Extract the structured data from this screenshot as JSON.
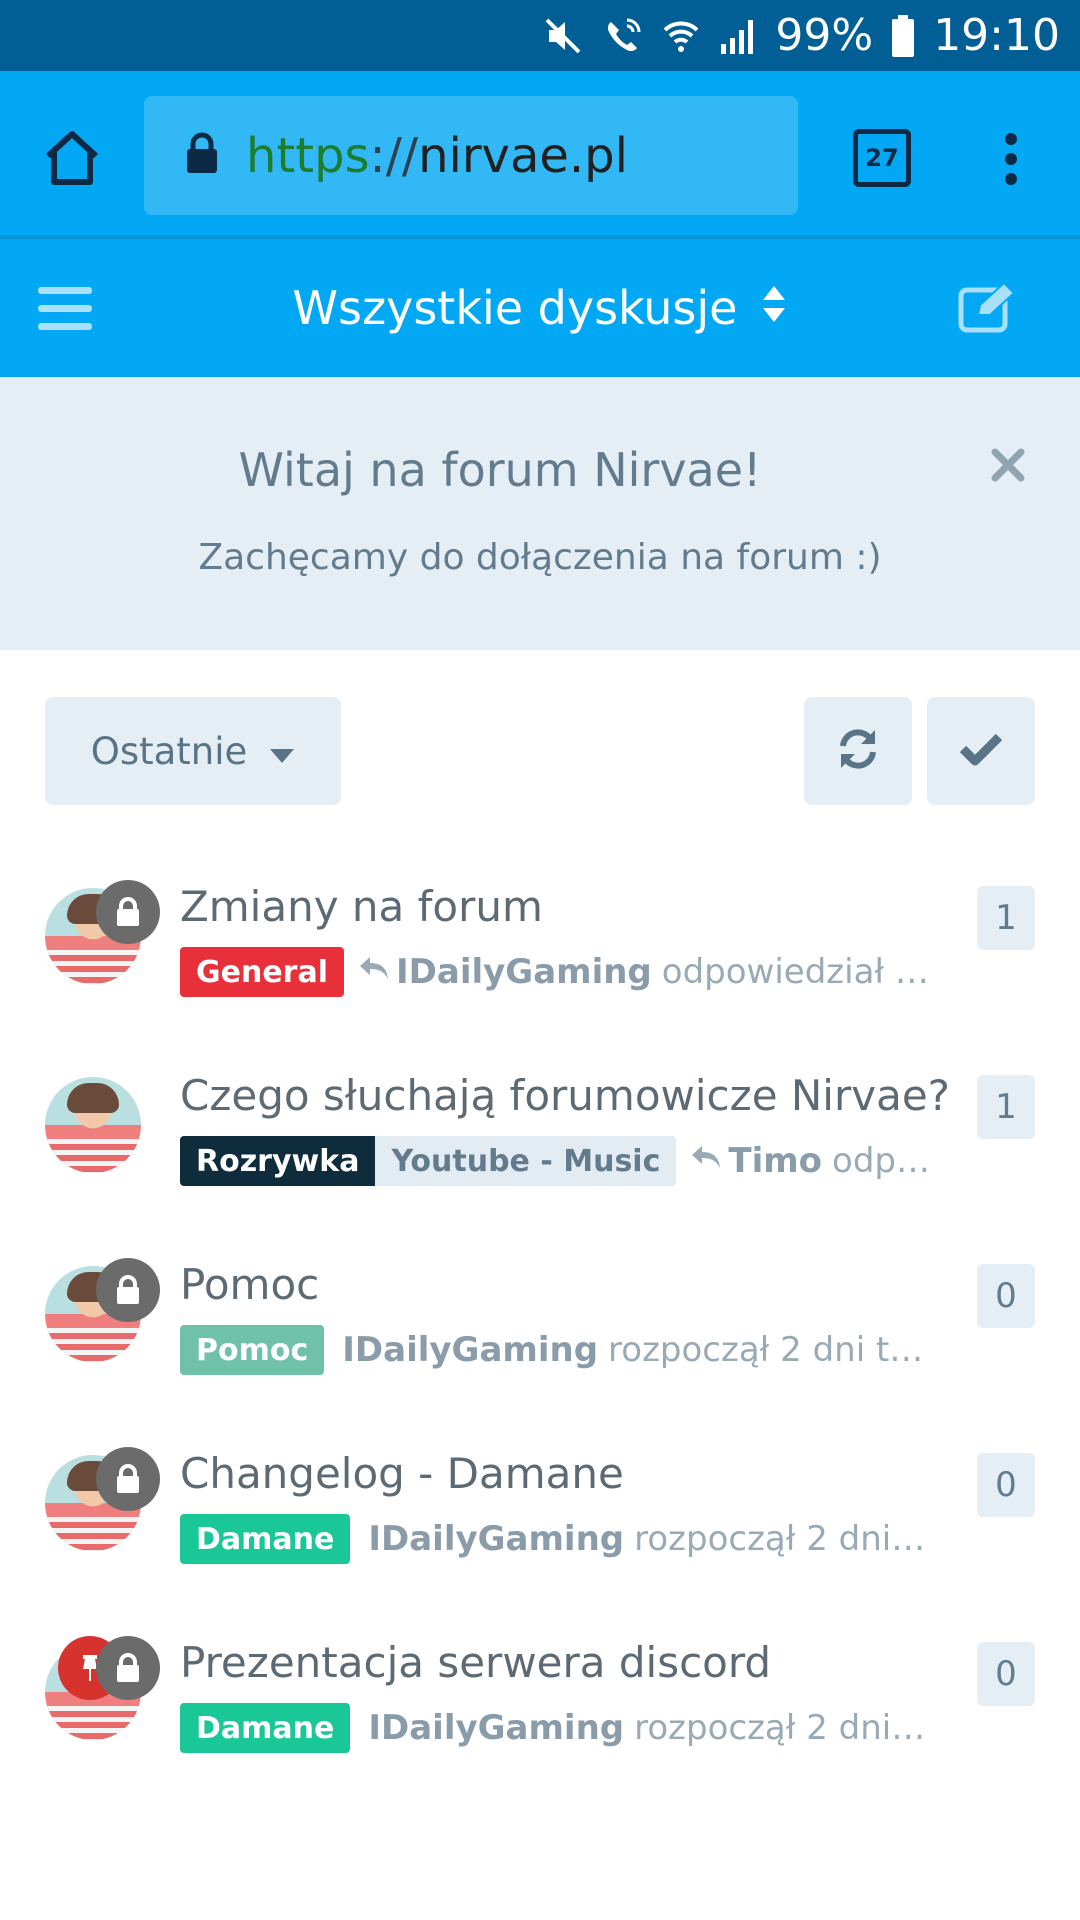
{
  "status_bar": {
    "battery_percent": "99%",
    "time": "19:10",
    "icons": [
      "mute-icon",
      "wifi-calling-icon",
      "wifi-icon",
      "signal-icon",
      "battery-icon"
    ]
  },
  "browser": {
    "url_scheme": "https",
    "url_separator": "://",
    "url_host": "nirvae.pl",
    "tab_count": "27"
  },
  "header": {
    "title": "Wszystkie dyskusje"
  },
  "welcome": {
    "title": "Witaj na forum Nirvae!",
    "subtitle": "Zachęcamy do dołączenia na forum :)"
  },
  "toolbar": {
    "sort_label": "Ostatnie"
  },
  "colors": {
    "primary": "#03a8f4",
    "status_bar": "#015f95",
    "tag_general": "#e8303a",
    "tag_rozrywka": "#0e2c3b",
    "tag_youtube_music": "#e3ecf3",
    "tag_pomoc": "#6fc2a8",
    "tag_damane": "#1ac897"
  },
  "discussions": [
    {
      "title": "Zmiany na forum",
      "tags": [
        {
          "label": "General",
          "color": "#e8303a"
        }
      ],
      "reply": true,
      "user": "IDailyGaming",
      "action": "odpowiedział je...",
      "count": "1",
      "locked": true,
      "pinned": false
    },
    {
      "title": "Czego słuchają forumowicze Nirvae?",
      "tags": [
        {
          "label": "Rozrywka",
          "color": "#0e2c3b"
        },
        {
          "label": "Youtube - Music",
          "color": "#e3ecf3"
        }
      ],
      "reply": true,
      "user": "Timo",
      "action": "odpowi...",
      "count": "1",
      "locked": false,
      "pinned": false
    },
    {
      "title": "Pomoc",
      "tags": [
        {
          "label": "Pomoc",
          "color": "#6fc2a8"
        }
      ],
      "reply": false,
      "user": "IDailyGaming",
      "action": "rozpoczął 2 dni te...",
      "count": "0",
      "locked": true,
      "pinned": false
    },
    {
      "title": "Changelog - Damane",
      "tags": [
        {
          "label": "Damane",
          "color": "#1ac897"
        }
      ],
      "reply": false,
      "user": "IDailyGaming",
      "action": "rozpoczął 2 dni te...",
      "count": "0",
      "locked": true,
      "pinned": false
    },
    {
      "title": "Prezentacja serwera discord",
      "tags": [
        {
          "label": "Damane",
          "color": "#1ac897"
        }
      ],
      "reply": false,
      "user": "IDailyGaming",
      "action": "rozpoczął 2 dni te...",
      "count": "0",
      "locked": true,
      "pinned": true
    }
  ]
}
